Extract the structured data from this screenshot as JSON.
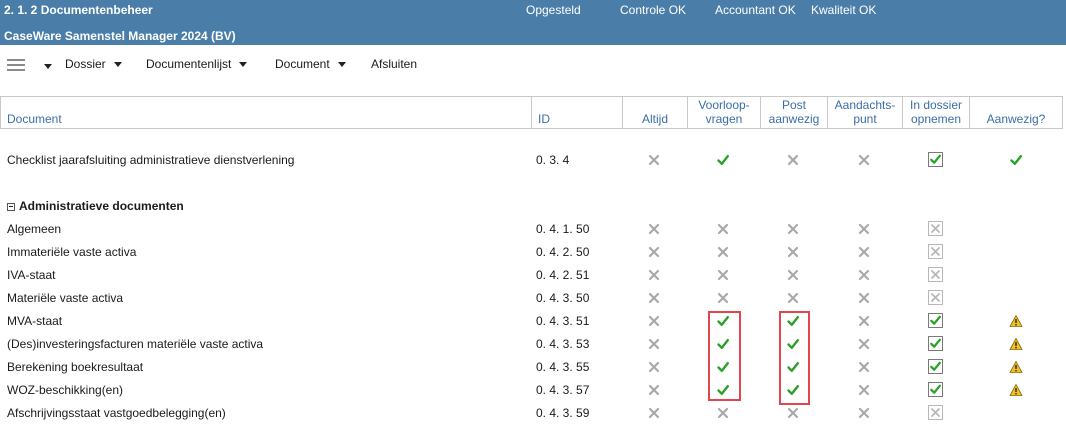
{
  "header": {
    "title": "2. 1.  2 Documentenbeheer",
    "subtitle": "CaseWare Samenstel Manager 2024 (BV)",
    "statuses": [
      "Opgesteld",
      "Controle OK",
      "Accountant OK",
      "Kwaliteit OK"
    ]
  },
  "menubar": {
    "items": [
      "Dossier",
      "Documentenlijst",
      "Document",
      "Afsluiten"
    ]
  },
  "columns": [
    "Document",
    "ID",
    "Altijd",
    "Voorloop-\nvragen",
    "Post\naanwezig",
    "Aandachts-\npunt",
    "In dossier\nopnemen",
    "Aanwezig?"
  ],
  "icons": {
    "cross": "grey-cross-icon",
    "check": "green-check-icon",
    "warning": "warning-triangle-icon",
    "checkbox": "checkbox-icon",
    "menu": "hamburger-menu-icon",
    "collapse": "collapse-minus-icon"
  },
  "colors": {
    "header_bg": "#4a7ea8",
    "check": "#2aa12a",
    "cross": "#a9a9a9",
    "highlight": "#e0474c",
    "warning": "#f0c020"
  },
  "top_row": {
    "doc": "Checklist jaarafsluiting administratieve dienstverlening",
    "id": "0. 3.  4",
    "altijd": "x",
    "voorloop": "v",
    "post": "x",
    "aandacht": "x",
    "opnemen": "checked",
    "aanwezig": "v"
  },
  "group": {
    "title": "Administratieve documenten"
  },
  "rows": [
    {
      "doc": "Algemeen",
      "id": "0. 4.  1. 50",
      "altijd": "x",
      "voorloop": "x",
      "post": "x",
      "aandacht": "x",
      "opnemen": "disabled",
      "aanwezig": ""
    },
    {
      "doc": "Immateriële vaste activa",
      "id": "0. 4.  2. 50",
      "altijd": "x",
      "voorloop": "x",
      "post": "x",
      "aandacht": "x",
      "opnemen": "disabled",
      "aanwezig": ""
    },
    {
      "doc": "IVA-staat",
      "id": "0. 4.  2. 51",
      "altijd": "x",
      "voorloop": "x",
      "post": "x",
      "aandacht": "x",
      "opnemen": "disabled",
      "aanwezig": ""
    },
    {
      "doc": "Materiële vaste activa",
      "id": "0. 4.  3. 50",
      "altijd": "x",
      "voorloop": "x",
      "post": "x",
      "aandacht": "x",
      "opnemen": "disabled",
      "aanwezig": ""
    },
    {
      "doc": "MVA-staat",
      "id": "0. 4.  3. 51",
      "altijd": "x",
      "voorloop": "v",
      "post": "v",
      "aandacht": "x",
      "opnemen": "checked",
      "aanwezig": "warn"
    },
    {
      "doc": "(Des)investeringsfacturen materiële vaste activa",
      "id": "0. 4.  3. 53",
      "altijd": "x",
      "voorloop": "v",
      "post": "v",
      "aandacht": "x",
      "opnemen": "checked",
      "aanwezig": "warn"
    },
    {
      "doc": "Berekening boekresultaat",
      "id": "0. 4.  3. 55",
      "altijd": "x",
      "voorloop": "v",
      "post": "v",
      "aandacht": "x",
      "opnemen": "checked",
      "aanwezig": "warn"
    },
    {
      "doc": "WOZ-beschikking(en)",
      "id": "0. 4.  3. 57",
      "altijd": "x",
      "voorloop": "v",
      "post": "v",
      "aandacht": "x",
      "opnemen": "checked",
      "aanwezig": "warn"
    },
    {
      "doc": "Afschrijvingsstaat vastgoedbelegging(en)",
      "id": "0. 4.  3. 59",
      "altijd": "x",
      "voorloop": "x",
      "post": "x",
      "aandacht": "x",
      "opnemen": "disabled",
      "aanwezig": ""
    }
  ]
}
